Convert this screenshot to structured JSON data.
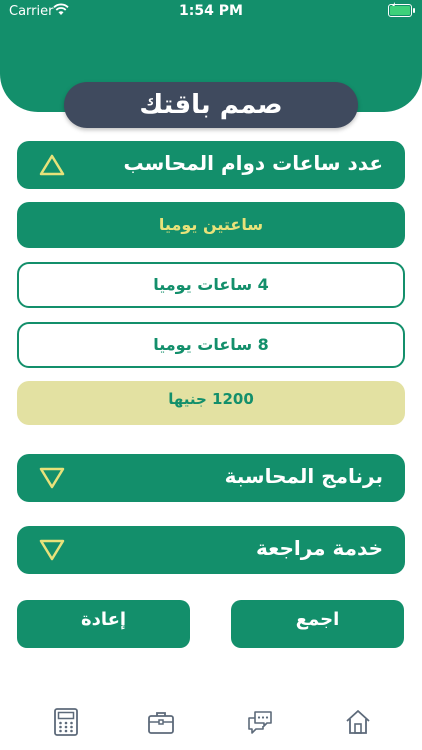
{
  "status_bar": {
    "carrier": "Carrier",
    "time": "1:54 PM"
  },
  "title": "صمم باقتك",
  "sections": {
    "accountant_hours": {
      "label": "عدد ساعات دوام المحاسب",
      "expanded": true
    },
    "accounting_software": {
      "label": "برنامج المحاسبة",
      "expanded": false
    },
    "audit_service": {
      "label": "خدمة مراجعة",
      "expanded": false
    }
  },
  "options": [
    {
      "label": "ساعتين يوميا",
      "selected": true
    },
    {
      "label": "4 ساعات يوميا",
      "selected": false
    },
    {
      "label": "8 ساعات يوميا",
      "selected": false
    }
  ],
  "price": "1200 جنيها",
  "buttons": {
    "sum": "اجمع",
    "reset": "إعادة"
  },
  "tabbar": {
    "icons": [
      "calculator-icon",
      "briefcase-icon",
      "chat-icon",
      "home-icon"
    ],
    "active_icon": "calculator-icon"
  },
  "colors": {
    "primary_green": "#138f6b",
    "title_pill": "#3f4a5e",
    "highlight_yellow": "#e8e27a",
    "price_bg": "#e3e1a2",
    "triangle": "#e8e27a",
    "tab_icon": "#5d6a7a"
  }
}
